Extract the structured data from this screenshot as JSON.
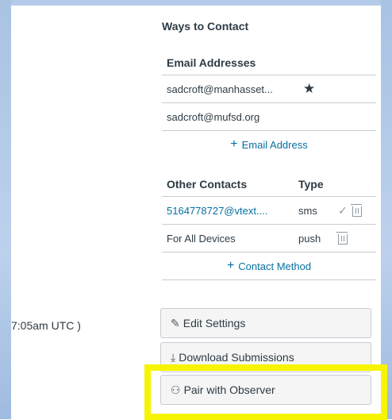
{
  "profile": {
    "time_fragment": "7:05am UTC )",
    "ways_to_contact": {
      "heading": "Ways to Contact",
      "email_table": {
        "header": "Email Addresses",
        "rows": [
          {
            "address": "sadcroft@manhasset...",
            "default_icon": "star-icon"
          },
          {
            "address": "sadcroft@mufsd.org"
          }
        ],
        "add_label": "Email Address"
      },
      "other_table": {
        "headers": [
          "Other Contacts",
          "Type"
        ],
        "rows": [
          {
            "contact": "5164778727@vtext....",
            "type": "sms"
          },
          {
            "contact": "For All Devices",
            "type": "push"
          }
        ],
        "add_label": "Contact Method"
      }
    },
    "buttons": {
      "edit": "Edit Settings",
      "download": "Download Submissions",
      "pair": "Pair with Observer"
    }
  },
  "colors": {
    "link": "#0770a3",
    "text": "#2d3b45",
    "highlight": "#f6f400"
  }
}
